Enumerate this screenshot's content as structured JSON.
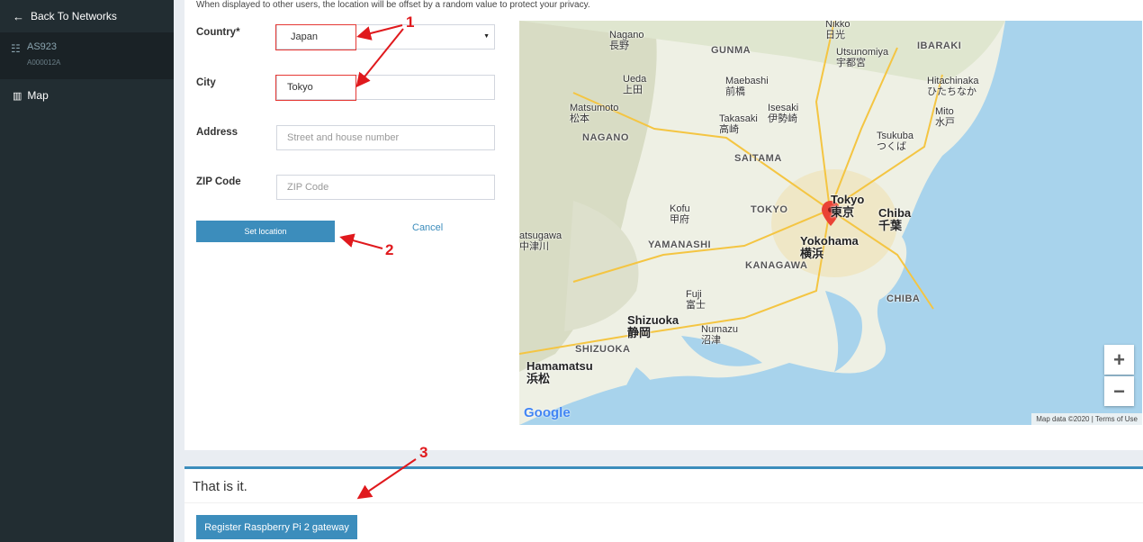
{
  "sidebar": {
    "back_label": "Back To Networks",
    "network_name": "AS923",
    "network_id": "A000012A",
    "map_label": "Map"
  },
  "form": {
    "privacy_note": "When displayed to other users, the location will be offset by a random value to protect your privacy.",
    "country_label": "Country*",
    "country_value": "Japan",
    "city_label": "City",
    "city_value": "Tokyo",
    "address_label": "Address",
    "address_placeholder": "Street and house number",
    "zip_label": "ZIP Code",
    "zip_placeholder": "ZIP Code",
    "set_location_button": "Set location",
    "cancel_link": "Cancel"
  },
  "map": {
    "zoom_in": "+",
    "zoom_out": "−",
    "logo": "Google",
    "footer": "Map data ©2020  |  Terms of Use",
    "labels": {
      "nagano": "Nagano\n長野",
      "gunma": "GUNMA",
      "nikko": "Nikko\n日光",
      "ibaraki": "IBARAKI",
      "utsunomiya": "Utsunomiya\n宇都宮",
      "ueda": "Ueda\n上田",
      "maebashi": "Maebashi\n前橋",
      "hitachinaka": "Hitachinaka\nひたちなか",
      "matsumoto": "Matsumoto\n松本",
      "isesaki": "Isesaki\n伊勢崎",
      "takasaki": "Takasaki\n高崎",
      "mito": "Mito\n水戸",
      "nagano_pref": "NAGANO",
      "tsukuba": "Tsukuba\nつくば",
      "saitama": "SAITAMA",
      "kofu": "Kofu\n甲府",
      "tokyo_pref": "TOKYO",
      "tokyo": "Tokyo\n東京",
      "chiba": "Chiba\n千葉",
      "atsugawa": "atsugawa\n中津川",
      "yamanashi": "YAMANASHI",
      "yokohama": "Yokohama\n横浜",
      "kanagawa": "KANAGAWA",
      "fuji": "Fuji\n富士",
      "chiba_pref": "CHIBA",
      "shizuoka": "Shizuoka\n静岡",
      "numazu": "Numazu\n沼津",
      "shizuoka_pref": "SHIZUOKA",
      "hamamatsu": "Hamamatsu\n浜松"
    }
  },
  "bottom": {
    "that_is_it": "That is it.",
    "register_button": "Register Raspberry Pi 2 gateway"
  },
  "annotations": [
    "1",
    "2",
    "3"
  ],
  "colors": {
    "sidebar_bg": "#222d32",
    "accent": "#3c8dbc",
    "annotation_red": "#e0191d"
  }
}
